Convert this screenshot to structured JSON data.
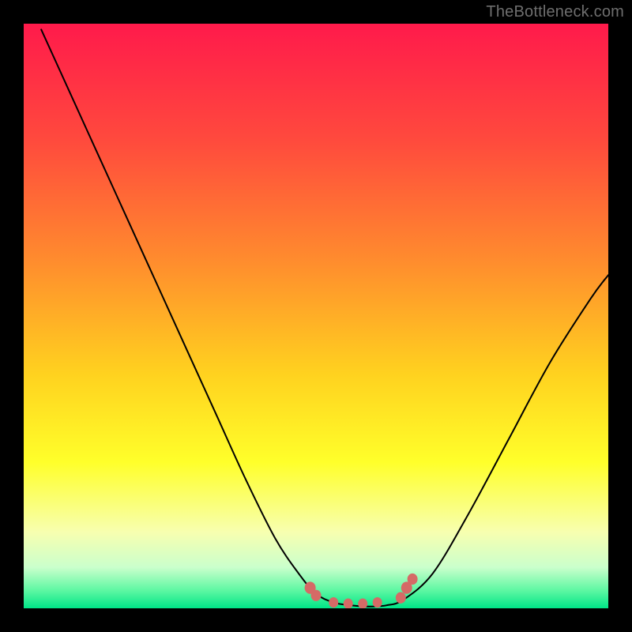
{
  "watermark": "TheBottleneck.com",
  "chart_data": {
    "type": "line",
    "title": "",
    "xlabel": "",
    "ylabel": "",
    "xlim": [
      0,
      1
    ],
    "ylim": [
      0,
      1
    ],
    "background_gradient": {
      "direction": "vertical",
      "stops": [
        {
          "pos": 0.0,
          "color": "#ff1a4b"
        },
        {
          "pos": 0.2,
          "color": "#ff4a3d"
        },
        {
          "pos": 0.4,
          "color": "#ff8a2e"
        },
        {
          "pos": 0.6,
          "color": "#ffd21f"
        },
        {
          "pos": 0.75,
          "color": "#ffff2a"
        },
        {
          "pos": 0.87,
          "color": "#f7ffb0"
        },
        {
          "pos": 0.93,
          "color": "#caffcc"
        },
        {
          "pos": 0.97,
          "color": "#5cf7a2"
        },
        {
          "pos": 1.0,
          "color": "#00e587"
        }
      ]
    },
    "series": [
      {
        "name": "curve",
        "x": [
          0.03,
          0.08,
          0.13,
          0.18,
          0.23,
          0.28,
          0.33,
          0.38,
          0.43,
          0.47,
          0.5,
          0.53,
          0.56,
          0.59,
          0.62,
          0.65,
          0.7,
          0.76,
          0.83,
          0.9,
          0.97,
          1.0
        ],
        "y": [
          0.99,
          0.88,
          0.77,
          0.66,
          0.55,
          0.44,
          0.33,
          0.22,
          0.12,
          0.06,
          0.025,
          0.01,
          0.005,
          0.003,
          0.005,
          0.015,
          0.06,
          0.16,
          0.29,
          0.42,
          0.53,
          0.57
        ],
        "color": "#000000",
        "width": 2
      }
    ],
    "markers": [
      {
        "name": "left-cluster-a",
        "x": 0.49,
        "y": 0.035,
        "size": 14
      },
      {
        "name": "left-cluster-b",
        "x": 0.5,
        "y": 0.022,
        "size": 13
      },
      {
        "name": "bottom-a",
        "x": 0.53,
        "y": 0.01,
        "size": 12
      },
      {
        "name": "bottom-b",
        "x": 0.555,
        "y": 0.008,
        "size": 12
      },
      {
        "name": "bottom-c",
        "x": 0.58,
        "y": 0.008,
        "size": 12
      },
      {
        "name": "bottom-d",
        "x": 0.605,
        "y": 0.01,
        "size": 12
      },
      {
        "name": "right-cluster-a",
        "x": 0.645,
        "y": 0.018,
        "size": 13
      },
      {
        "name": "right-cluster-b",
        "x": 0.655,
        "y": 0.035,
        "size": 14
      },
      {
        "name": "right-cluster-c",
        "x": 0.665,
        "y": 0.05,
        "size": 13
      }
    ],
    "marker_color": "#d56a66"
  }
}
